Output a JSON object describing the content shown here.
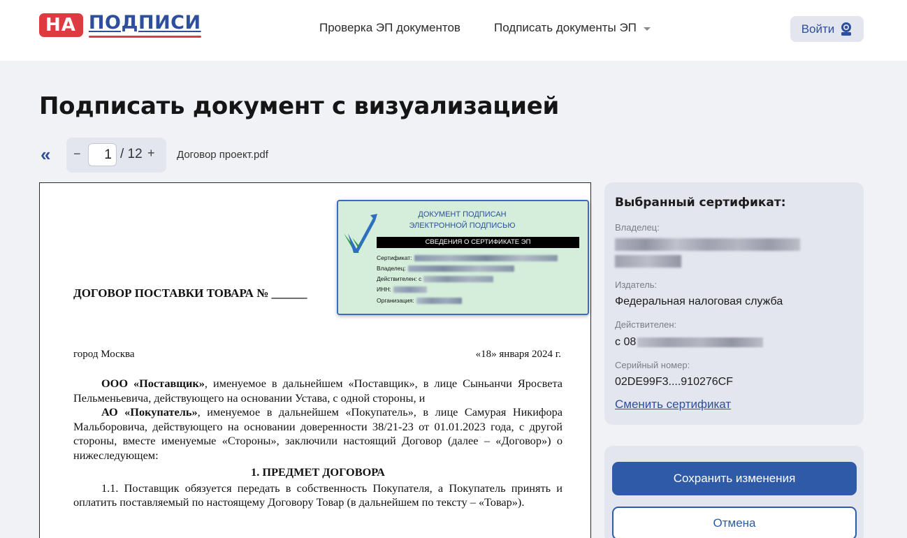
{
  "header": {
    "logo_badge": "НА",
    "logo_word": "ПОДПИСИ",
    "nav": [
      {
        "label": "Проверка ЭП документов"
      },
      {
        "label": "Подписать документы ЭП"
      }
    ],
    "login_label": "Войти"
  },
  "page_title": "Подписать документ с визуализацией",
  "toolbar": {
    "back_glyph": "«",
    "minus": "−",
    "page_value": "1",
    "page_total": "/ 12",
    "plus": "+",
    "filename": "Договор проект.pdf"
  },
  "document": {
    "heading": "ДОГОВОР ПОСТАВКИ ТОВАРА № ______",
    "city": "город Москва",
    "date": "«18» января 2024 г.",
    "p1_bold": "ООО «Поставщик»",
    "p1_rest": ", именуемое в дальнейшем «Поставщик», в лице Сыньанчи Яросвета Пельменьевича, действующего на основании Устава, с одной стороны, и",
    "p2_bold": "АО «Покупатель»",
    "p2_rest": ", именуемое в дальнейшем «Покупатель», в лице Самурая Никифора Мальборовича, действующего на основании доверенности 38/21-23 от 01.01.2023 года, с другой стороны, вместе именуемые «Стороны», заключили настоящий Договор (далее – «Договор») о нижеследующем:",
    "section_title": "1. ПРЕДМЕТ ДОГОВОРА",
    "p3": "1.1. Поставщик обязуется передать в собственность Покупателя, а Покупатель принять и оплатить поставляемый по настоящему Договору Товар (в дальнейшем по тексту – «Товар»)."
  },
  "stamp": {
    "line1": "ДОКУМЕНТ ПОДПИСАН",
    "line2": "ЭЛЕКТРОННОЙ ПОДПИСЬЮ",
    "bar": "СВЕДЕНИЯ О СЕРТИФИКАТЕ ЭП",
    "rows": [
      {
        "label": "Сертификат:"
      },
      {
        "label": "Владелец:"
      },
      {
        "label": "Действителен: с"
      },
      {
        "label": "ИНН:"
      },
      {
        "label": "Организация:"
      }
    ]
  },
  "certificate": {
    "title": "Выбранный сертификат:",
    "owner_label": "Владелец:",
    "issuer_label": "Издатель:",
    "issuer_value": "Федеральная налоговая служба",
    "valid_label": "Действителен:",
    "valid_prefix": "с 08",
    "serial_label": "Серийный номер:",
    "serial_value": "02DE99F3....910276CF",
    "change_link": "Сменить сертификат"
  },
  "actions": {
    "save_label": "Сохранить изменения",
    "cancel_label": "Отмена"
  },
  "colors": {
    "brand_blue": "#2e5aa7",
    "brand_red": "#de3b40",
    "panel_bg": "#e3e5ef",
    "page_bg": "#f1f2f6",
    "stamp_bg": "#d4eedb"
  }
}
